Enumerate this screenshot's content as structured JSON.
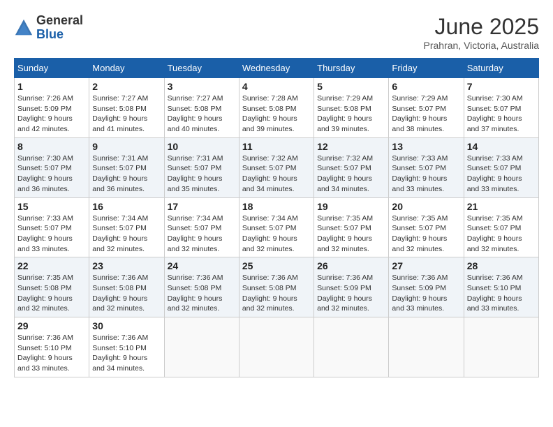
{
  "header": {
    "logo_general": "General",
    "logo_blue": "Blue",
    "month_year": "June 2025",
    "location": "Prahran, Victoria, Australia"
  },
  "columns": [
    "Sunday",
    "Monday",
    "Tuesday",
    "Wednesday",
    "Thursday",
    "Friday",
    "Saturday"
  ],
  "weeks": [
    [
      {
        "day": "1",
        "sunrise": "7:26 AM",
        "sunset": "5:09 PM",
        "daylight": "9 hours and 42 minutes."
      },
      {
        "day": "2",
        "sunrise": "7:27 AM",
        "sunset": "5:08 PM",
        "daylight": "9 hours and 41 minutes."
      },
      {
        "day": "3",
        "sunrise": "7:27 AM",
        "sunset": "5:08 PM",
        "daylight": "9 hours and 40 minutes."
      },
      {
        "day": "4",
        "sunrise": "7:28 AM",
        "sunset": "5:08 PM",
        "daylight": "9 hours and 39 minutes."
      },
      {
        "day": "5",
        "sunrise": "7:29 AM",
        "sunset": "5:08 PM",
        "daylight": "9 hours and 39 minutes."
      },
      {
        "day": "6",
        "sunrise": "7:29 AM",
        "sunset": "5:07 PM",
        "daylight": "9 hours and 38 minutes."
      },
      {
        "day": "7",
        "sunrise": "7:30 AM",
        "sunset": "5:07 PM",
        "daylight": "9 hours and 37 minutes."
      }
    ],
    [
      {
        "day": "8",
        "sunrise": "7:30 AM",
        "sunset": "5:07 PM",
        "daylight": "9 hours and 36 minutes."
      },
      {
        "day": "9",
        "sunrise": "7:31 AM",
        "sunset": "5:07 PM",
        "daylight": "9 hours and 36 minutes."
      },
      {
        "day": "10",
        "sunrise": "7:31 AM",
        "sunset": "5:07 PM",
        "daylight": "9 hours and 35 minutes."
      },
      {
        "day": "11",
        "sunrise": "7:32 AM",
        "sunset": "5:07 PM",
        "daylight": "9 hours and 34 minutes."
      },
      {
        "day": "12",
        "sunrise": "7:32 AM",
        "sunset": "5:07 PM",
        "daylight": "9 hours and 34 minutes."
      },
      {
        "day": "13",
        "sunrise": "7:33 AM",
        "sunset": "5:07 PM",
        "daylight": "9 hours and 33 minutes."
      },
      {
        "day": "14",
        "sunrise": "7:33 AM",
        "sunset": "5:07 PM",
        "daylight": "9 hours and 33 minutes."
      }
    ],
    [
      {
        "day": "15",
        "sunrise": "7:33 AM",
        "sunset": "5:07 PM",
        "daylight": "9 hours and 33 minutes."
      },
      {
        "day": "16",
        "sunrise": "7:34 AM",
        "sunset": "5:07 PM",
        "daylight": "9 hours and 32 minutes."
      },
      {
        "day": "17",
        "sunrise": "7:34 AM",
        "sunset": "5:07 PM",
        "daylight": "9 hours and 32 minutes."
      },
      {
        "day": "18",
        "sunrise": "7:34 AM",
        "sunset": "5:07 PM",
        "daylight": "9 hours and 32 minutes."
      },
      {
        "day": "19",
        "sunrise": "7:35 AM",
        "sunset": "5:07 PM",
        "daylight": "9 hours and 32 minutes."
      },
      {
        "day": "20",
        "sunrise": "7:35 AM",
        "sunset": "5:07 PM",
        "daylight": "9 hours and 32 minutes."
      },
      {
        "day": "21",
        "sunrise": "7:35 AM",
        "sunset": "5:07 PM",
        "daylight": "9 hours and 32 minutes."
      }
    ],
    [
      {
        "day": "22",
        "sunrise": "7:35 AM",
        "sunset": "5:08 PM",
        "daylight": "9 hours and 32 minutes."
      },
      {
        "day": "23",
        "sunrise": "7:36 AM",
        "sunset": "5:08 PM",
        "daylight": "9 hours and 32 minutes."
      },
      {
        "day": "24",
        "sunrise": "7:36 AM",
        "sunset": "5:08 PM",
        "daylight": "9 hours and 32 minutes."
      },
      {
        "day": "25",
        "sunrise": "7:36 AM",
        "sunset": "5:08 PM",
        "daylight": "9 hours and 32 minutes."
      },
      {
        "day": "26",
        "sunrise": "7:36 AM",
        "sunset": "5:09 PM",
        "daylight": "9 hours and 32 minutes."
      },
      {
        "day": "27",
        "sunrise": "7:36 AM",
        "sunset": "5:09 PM",
        "daylight": "9 hours and 33 minutes."
      },
      {
        "day": "28",
        "sunrise": "7:36 AM",
        "sunset": "5:10 PM",
        "daylight": "9 hours and 33 minutes."
      }
    ],
    [
      {
        "day": "29",
        "sunrise": "7:36 AM",
        "sunset": "5:10 PM",
        "daylight": "9 hours and 33 minutes."
      },
      {
        "day": "30",
        "sunrise": "7:36 AM",
        "sunset": "5:10 PM",
        "daylight": "9 hours and 34 minutes."
      },
      null,
      null,
      null,
      null,
      null
    ]
  ]
}
